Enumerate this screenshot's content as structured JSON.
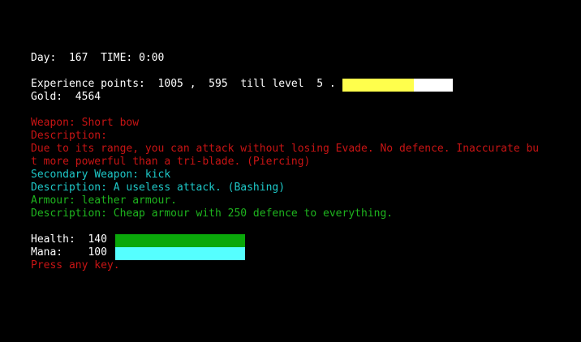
{
  "status": {
    "day_label": "Day:",
    "day_value": "167",
    "time_label": "TIME:",
    "time_value": "0:00"
  },
  "experience": {
    "label": "Experience points:",
    "points": "1005",
    "separator": ",",
    "remaining": "595",
    "till_label": "till level",
    "level": "5",
    "period": ".",
    "progress_fraction": 0.65,
    "fill_color": "#ffff4c",
    "empty_color": "#ffffff"
  },
  "gold": {
    "label": "Gold:",
    "value": "4564"
  },
  "weapon": {
    "line": "Weapon: Short bow",
    "desc_label": "Description:",
    "desc_line1": "Due to its range, you can attack without losing Evade. No defence. Inaccurate bu",
    "desc_line2": "t more powerful than a tri-blade. (Piercing)"
  },
  "secondary": {
    "line": "Secondary Weapon: kick",
    "desc_line": "Description: A useless attack. (Bashing)"
  },
  "armour": {
    "line": "Armour: leather armour.",
    "desc_line": "Description: Cheap armour with 250 defence to everything."
  },
  "health": {
    "label": "Health:",
    "value": "140",
    "fill_fraction": 1.0,
    "color": "#0aa80a"
  },
  "mana": {
    "label": "Mana:",
    "value": "100",
    "fill_fraction": 1.0,
    "color": "#55ffff"
  },
  "prompt": "Press any key.",
  "colors": {
    "text_white": "#ffffff",
    "text_red": "#c81414",
    "text_cyan": "#1ec8c8",
    "text_green": "#1eb41e",
    "background": "#000000"
  }
}
